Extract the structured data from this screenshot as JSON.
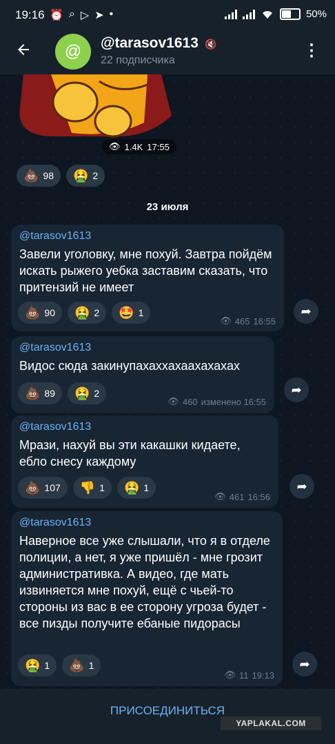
{
  "status_bar": {
    "time": "19:16",
    "battery": "50%"
  },
  "header": {
    "title": "@tarasov1613",
    "avatar_text": "@",
    "subtitle": "22 подписчика"
  },
  "sticker_message": {
    "views": "1.4K",
    "time": "17:55",
    "reactions": [
      {
        "emoji": "💩",
        "count": "98"
      },
      {
        "emoji": "🤮",
        "count": "2"
      }
    ]
  },
  "date_separator": "23 июля",
  "messages": [
    {
      "author": "@tarasov1613",
      "text": "Завели уголовку, мне похуй. Завтра пойдём искать рыжего уебка заставим сказать, что притензий не имеет",
      "reactions": [
        {
          "emoji": "💩",
          "count": "90"
        },
        {
          "emoji": "🤮",
          "count": "2"
        },
        {
          "emoji": "🤩",
          "count": "1"
        }
      ],
      "views": "465",
      "time": "16:55"
    },
    {
      "author": "@tarasov1613",
      "text": "Видос сюда закинупахаххахаахахахах",
      "reactions": [
        {
          "emoji": "💩",
          "count": "89"
        },
        {
          "emoji": "🤮",
          "count": "2"
        }
      ],
      "views": "460",
      "time": "изменено 16:55"
    },
    {
      "author": "@tarasov1613",
      "text": "Мрази, нахуй вы эти какашки кидаете, ебло снесу каждому",
      "reactions": [
        {
          "emoji": "💩",
          "count": "107"
        },
        {
          "emoji": "👎",
          "count": "1"
        },
        {
          "emoji": "🤮",
          "count": "1"
        }
      ],
      "views": "461",
      "time": "16:56"
    },
    {
      "author": "@tarasov1613",
      "text": "Наверное все уже слышали, что я в отделе полиции, а нет, я уже пришёл - мне грозит административка. А видео, где мать извиняется мне похуй, ещё с чьей-то стороны из вас в ее сторону угроза будет - все пизды получите ебаные пидорасы",
      "reactions": [
        {
          "emoji": "🤮",
          "count": "1"
        },
        {
          "emoji": "💩",
          "count": "1"
        }
      ],
      "views": "11",
      "time": "19:13"
    }
  ],
  "footer": {
    "join_label": "ПРИСОЕДИНИТЬСЯ"
  },
  "watermark": "YAPLAKAL.COM",
  "icons": {
    "views": "eye-icon",
    "share": "share-arrow-icon",
    "back": "back-arrow-icon",
    "menu": "more-vert-icon",
    "mute": "muted-icon"
  },
  "colors": {
    "background": "#0e1621",
    "bubble": "#182533",
    "header": "#17212b",
    "accent": "#6ab3f3",
    "avatar": "#8ed14e"
  }
}
